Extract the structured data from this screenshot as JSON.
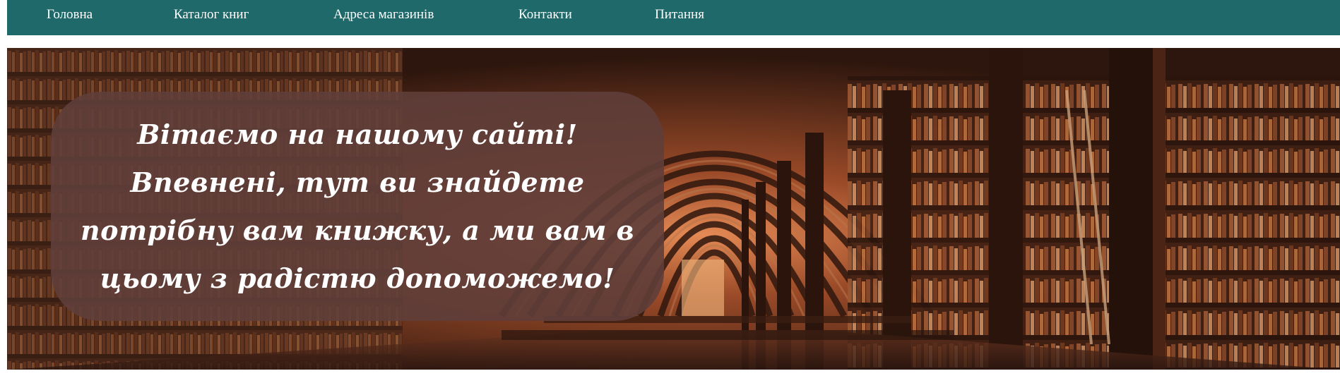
{
  "nav": {
    "items": [
      {
        "label": "Головна"
      },
      {
        "label": "Каталог книг"
      },
      {
        "label": "Адреса магазинів"
      },
      {
        "label": "Контакти"
      },
      {
        "label": "Питання"
      }
    ]
  },
  "hero": {
    "welcome_text": "Вітаємо на нашому сайті! Впевнені, тут ви знайдете потрібну вам книжку, а ми вам в цьому з радістю допоможемо!"
  },
  "colors": {
    "nav_background": "#20696a",
    "nav_text": "#ffffff",
    "overlay": "#5f3e3a"
  }
}
